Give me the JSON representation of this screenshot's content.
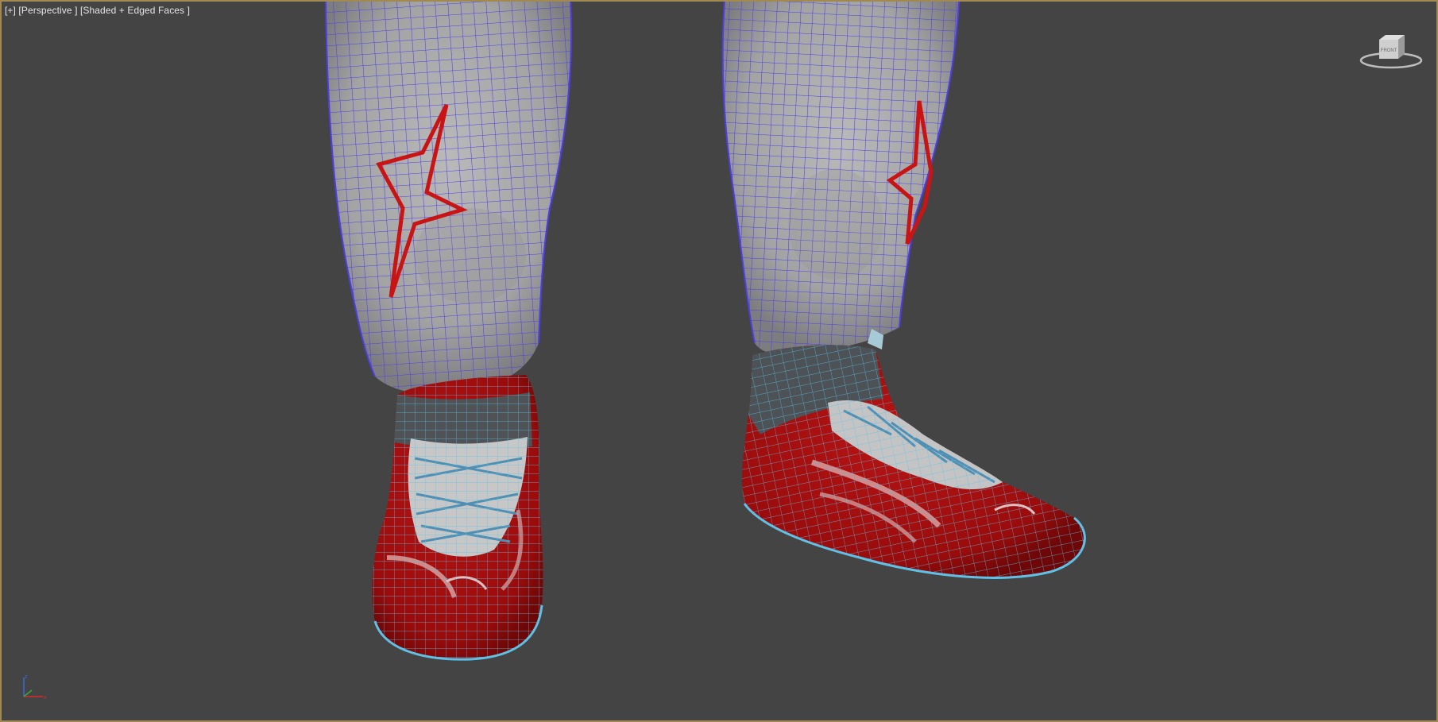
{
  "viewport": {
    "label_plus": "[+]",
    "label_view": "[Perspective ]",
    "label_shading": "[Shaded + Edged Faces ]"
  },
  "viewcube": {
    "face_label": "FRONT",
    "icon": "viewcube-icon"
  },
  "axis_tripod": {
    "icon": "axis-tripod-icon"
  },
  "colors": {
    "background": "#444444",
    "border": "#a08a52",
    "pants_surface": "#a9a9aa",
    "pants_wire": "#4d3ee6",
    "shoe_red": "#a50f0f",
    "shoe_wire": "#5fc1e6",
    "logo_red": "#c81414"
  }
}
